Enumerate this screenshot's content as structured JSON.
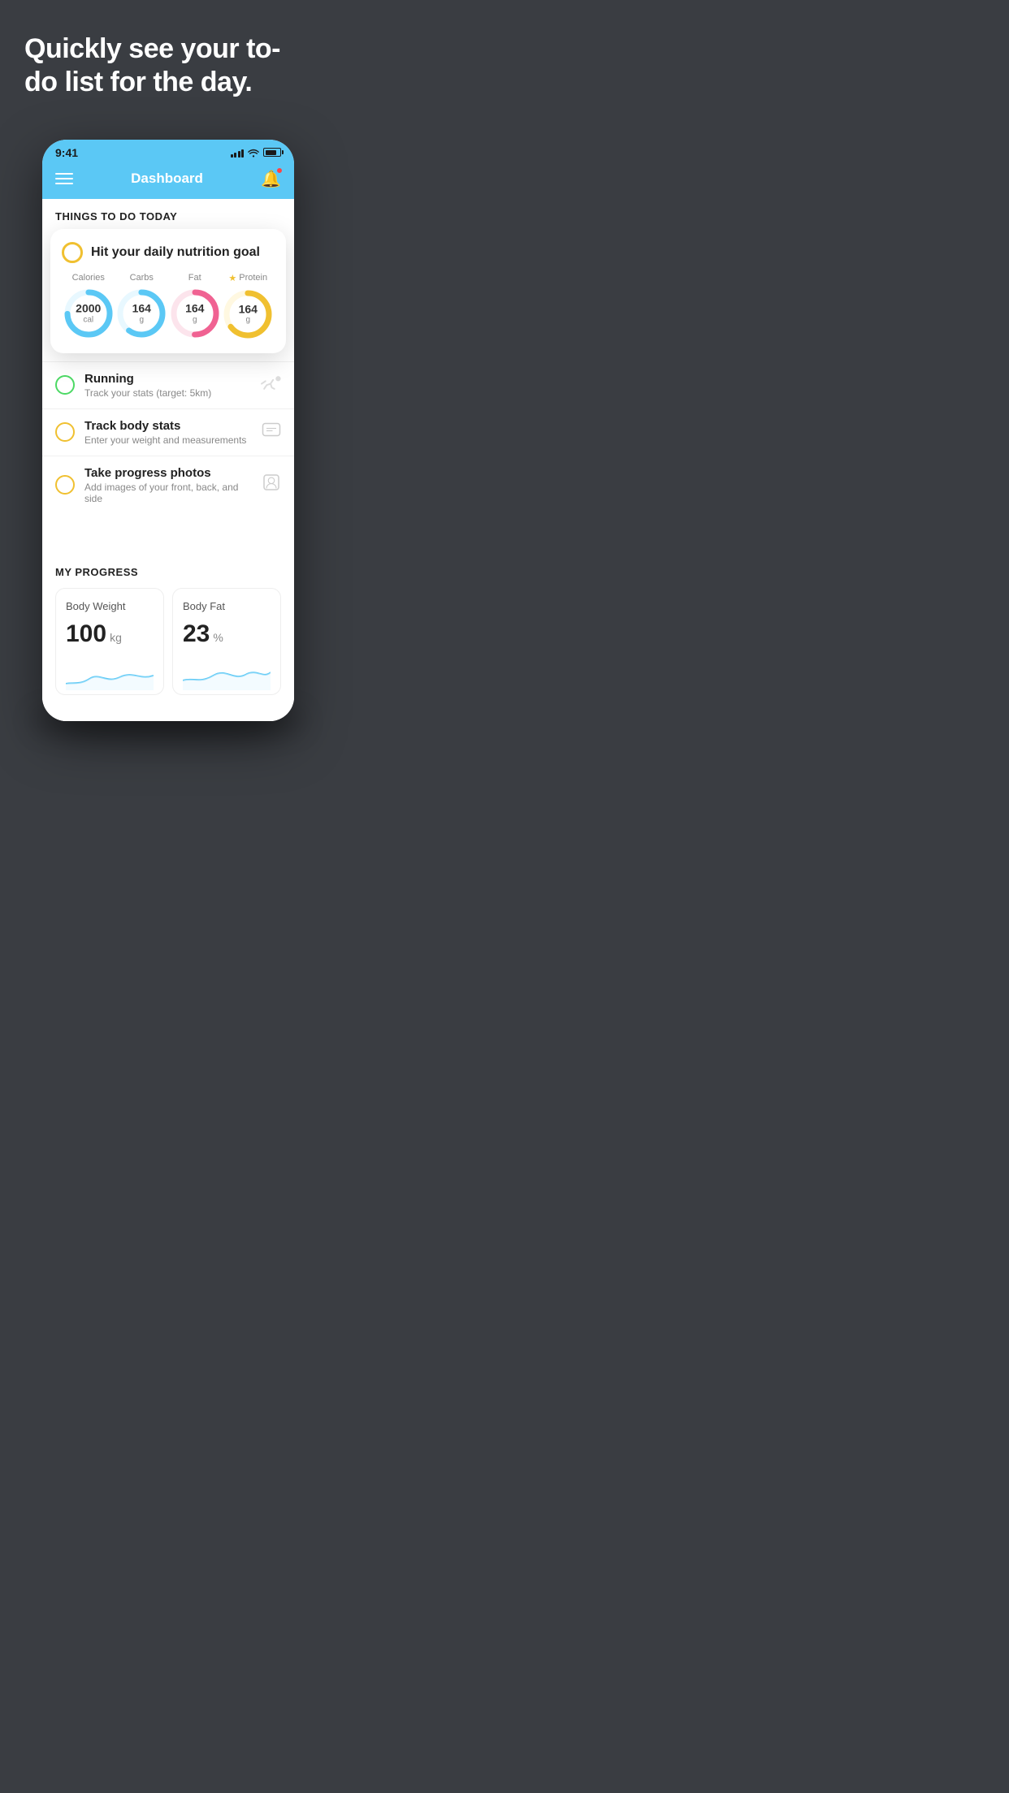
{
  "hero": {
    "title": "Quickly see your to-do list for the day."
  },
  "phone": {
    "status_bar": {
      "time": "9:41"
    },
    "nav": {
      "title": "Dashboard"
    },
    "things_header": "THINGS TO DO TODAY",
    "floating_card": {
      "title": "Hit your daily nutrition goal",
      "nutrition": [
        {
          "label": "Calories",
          "value": "2000",
          "unit": "cal",
          "color": "#5bc8f5",
          "track_bg": "#e8f8ff",
          "percent": 75,
          "star": false
        },
        {
          "label": "Carbs",
          "value": "164",
          "unit": "g",
          "color": "#5bc8f5",
          "track_bg": "#e8f8ff",
          "percent": 60,
          "star": false
        },
        {
          "label": "Fat",
          "value": "164",
          "unit": "g",
          "color": "#f06292",
          "track_bg": "#fce4ec",
          "percent": 50,
          "star": false
        },
        {
          "label": "Protein",
          "value": "164",
          "unit": "g",
          "color": "#f0c030",
          "track_bg": "#fff8e1",
          "percent": 65,
          "star": true
        }
      ]
    },
    "todo_items": [
      {
        "name": "Running",
        "desc": "Track your stats (target: 5km)",
        "circle_color": "green",
        "icon": "👟"
      },
      {
        "name": "Track body stats",
        "desc": "Enter your weight and measurements",
        "circle_color": "yellow",
        "icon": "⚖"
      },
      {
        "name": "Take progress photos",
        "desc": "Add images of your front, back, and side",
        "circle_color": "yellow",
        "icon": "👤"
      }
    ],
    "progress": {
      "header": "MY PROGRESS",
      "cards": [
        {
          "title": "Body Weight",
          "value": "100",
          "unit": "kg"
        },
        {
          "title": "Body Fat",
          "value": "23",
          "unit": "%"
        }
      ]
    }
  }
}
